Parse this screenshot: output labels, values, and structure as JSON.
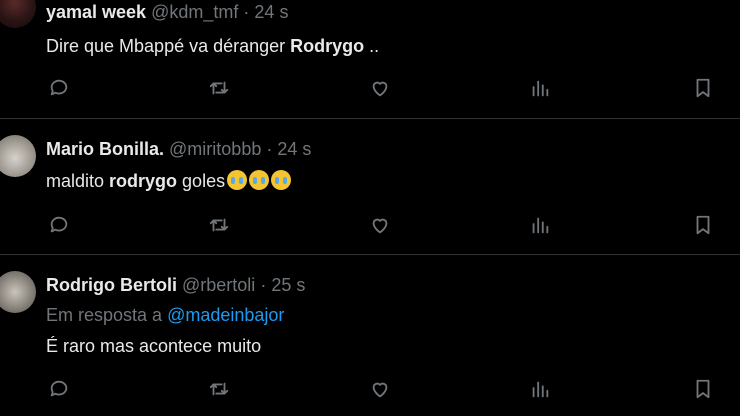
{
  "tweets": [
    {
      "name": "yamal week",
      "handle": "@kdm_tmf",
      "sep": "·",
      "time": "24 s",
      "text_before": "Dire que Mbappé va déranger ",
      "text_bold": "Rodrygo",
      "text_after": " .."
    },
    {
      "name": "Mario Bonilla.",
      "handle": "@miritobbb",
      "sep": "·",
      "time": "24 s",
      "text_before": "maldito ",
      "text_bold": "rodrygo",
      "text_after": " goles",
      "emojis": [
        "loudly-crying-face",
        "loudly-crying-face",
        "loudly-crying-face"
      ]
    },
    {
      "name": "Rodrigo Bertoli",
      "handle": "@rbertoli",
      "sep": "·",
      "time": "25 s",
      "reply_prefix": "Em resposta a ",
      "reply_to": "@madeinbajor",
      "text": "É raro mas acontece muito"
    }
  ],
  "actions": [
    "reply-icon",
    "retweet-icon",
    "like-icon",
    "views-icon",
    "bookmark-icon"
  ],
  "colors": {
    "background": "#000000",
    "text": "#e7e9ea",
    "muted": "#71767b",
    "accent": "#1d9bf0",
    "divider": "#2f3336"
  }
}
